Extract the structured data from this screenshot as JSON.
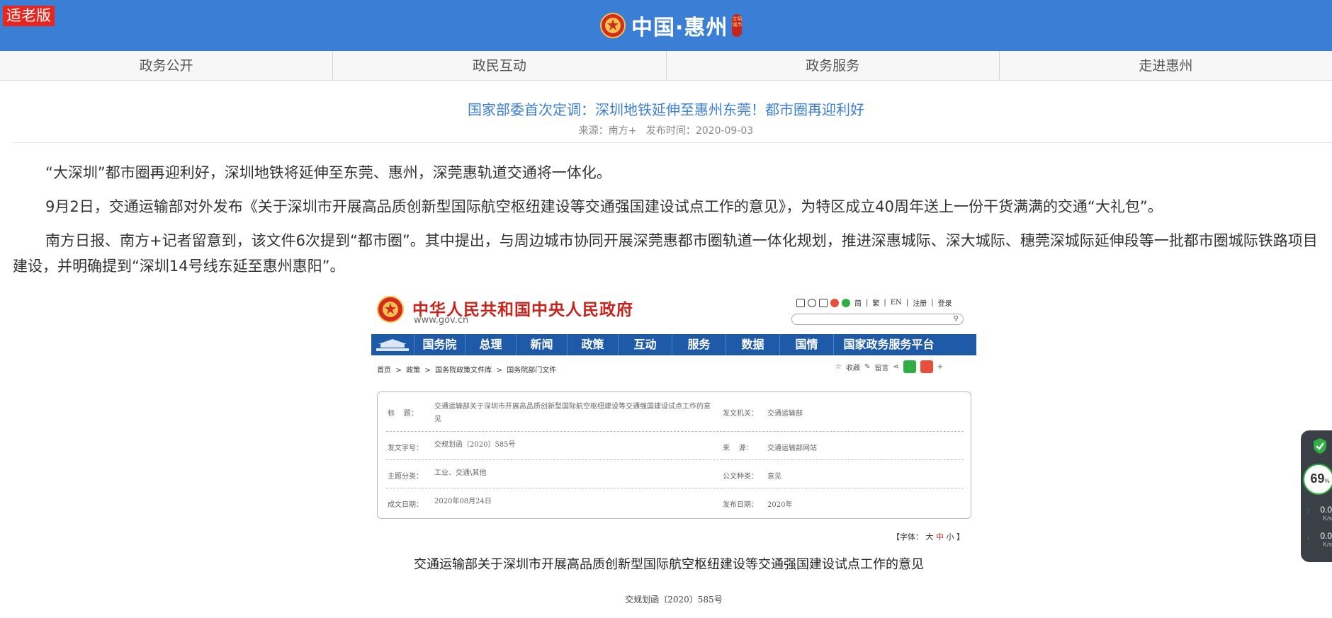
{
  "header": {
    "elder_mode": "适老版",
    "brand_title": "中国·惠州",
    "seal_text": "文明城市"
  },
  "nav": {
    "items": [
      "政务公开",
      "政民互动",
      "政务服务",
      "走进惠州"
    ]
  },
  "article": {
    "title": "国家部委首次定调：深圳地铁延伸至惠州东莞！都市圈再迎利好",
    "meta": "来源：南方+   发布时间：2020-09-03",
    "paragraphs": [
      "“大深圳”都市圈再迎利好，深圳地铁将延伸至东莞、惠州，深莞惠轨道交通将一体化。",
      "9月2日，交通运输部对外发布《关于深圳市开展高品质创新型国际航空枢纽建设等交通强国建设试点工作的意见》，为特区成立40周年送上一份干货满满的交通“大礼包”。",
      "南方日报、南方+记者留意到，该文件6次提到“都市圈”。其中提出，与周边城市协同开展深莞惠都市圈轨道一体化规划，推进深惠城际、深大城际、穗莞深城际延伸段等一批都市圈城际铁路项目建设，并明确提到“深圳14号线东延至惠州惠阳”。"
    ]
  },
  "embedded": {
    "gov_title": "中华人民共和国中央人民政府",
    "gov_url": "www.gov.cn",
    "top_links": [
      "简",
      "繁",
      "EN",
      "注册",
      "登录"
    ],
    "nav_items": [
      "国务院",
      "总理",
      "新闻",
      "政策",
      "互动",
      "服务",
      "数据",
      "国情",
      "国家政务服务平台"
    ],
    "breadcrumb": "首页  >  政策  >  国务院政策文件库  >  国务院部门文件",
    "actions": {
      "favorite": "收藏",
      "comment": "留言"
    },
    "info": {
      "title_key": "标    题：",
      "title_val": "交通运输部关于深圳市开展高品质创新型国际航空枢纽建设等交通强国建设试点工作的意见",
      "issuer_key": "发文机关：",
      "issuer_val": "交通运输部",
      "docno_key": "发文字号：",
      "docno_val": "交规划函〔2020〕585号",
      "source_key": "来    源：",
      "source_val": "交通运输部网站",
      "topic_key": "主题分类：",
      "topic_val": "工业、交通\\其他",
      "type_key": "公文种类：",
      "type_val": "意见",
      "date_key": "成文日期：",
      "date_val": "2020年08月24日",
      "pub_key": "发布日期：",
      "pub_val": "2020年"
    },
    "font_size": {
      "label": "【字体：",
      "large": "大",
      "medium": "中",
      "small": "小",
      "close": "】"
    },
    "doc_title": "交通运输部关于深圳市开展高品质创新型国际航空枢纽建设等交通强国建设试点工作的意见",
    "doc_no": "交规划函〔2020〕585号"
  },
  "monitor": {
    "percent": "69",
    "percent_unit": "%",
    "upload": "0.0",
    "download": "0.0",
    "unit": "K/s"
  }
}
